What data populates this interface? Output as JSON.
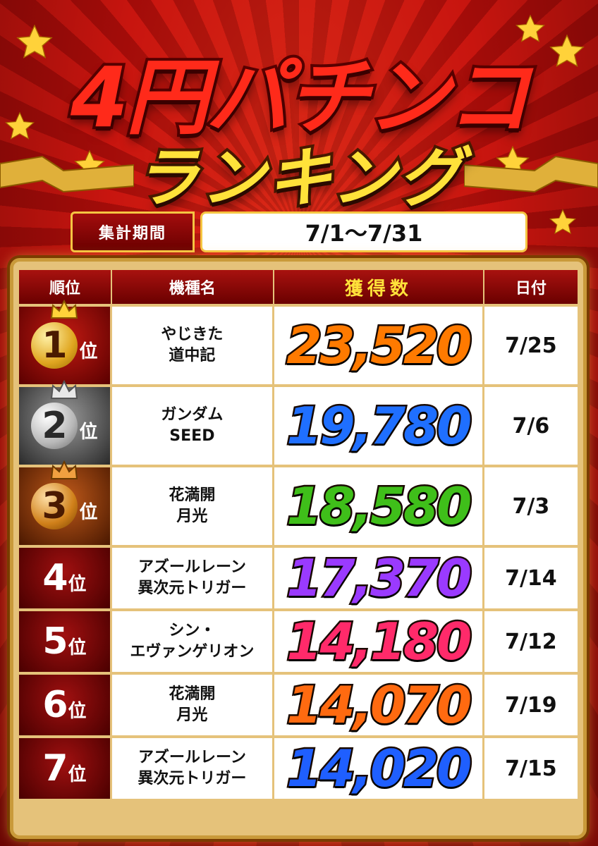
{
  "header": {
    "title_line1": "4円パチンコ",
    "title_line2": "ランキング"
  },
  "period": {
    "label": "集計期間",
    "value": "7/1〜7/31"
  },
  "table": {
    "columns": [
      "順位",
      "機種名",
      "獲得数",
      "日付"
    ],
    "rank_suffix": "位",
    "rows": [
      {
        "rank": "1",
        "machine_line1": "やじきた",
        "machine_line2": "道中記",
        "score": "23,520",
        "date": "7/25",
        "score_color": "#ff7a00"
      },
      {
        "rank": "2",
        "machine_line1": "ガンダム",
        "machine_line2": "SEED",
        "score": "19,780",
        "date": "7/6",
        "score_color": "#1f6fff"
      },
      {
        "rank": "3",
        "machine_line1": "花満開",
        "machine_line2": "月光",
        "score": "18,580",
        "date": "7/3",
        "score_color": "#3fbf1a"
      },
      {
        "rank": "4",
        "machine_line1": "アズールレーン",
        "machine_line2": "異次元トリガー",
        "score": "17,370",
        "date": "7/14",
        "score_color": "#9a3aff"
      },
      {
        "rank": "5",
        "machine_line1": "シン・",
        "machine_line2": "エヴァンゲリオン",
        "score": "14,180",
        "date": "7/12",
        "score_color": "#ff2a6a"
      },
      {
        "rank": "6",
        "machine_line1": "花満開",
        "machine_line2": "月光",
        "score": "14,070",
        "date": "7/19",
        "score_color": "#ff6a10"
      },
      {
        "rank": "7",
        "machine_line1": "アズールレーン",
        "machine_line2": "異次元トリガー",
        "score": "14,020",
        "date": "7/15",
        "score_color": "#1f5fff"
      }
    ]
  },
  "colors": {
    "background": "#c8150f",
    "title_red": "#ff2a1a",
    "title_yellow": "#ffe23a",
    "frame_gold": "#e5c27a"
  }
}
